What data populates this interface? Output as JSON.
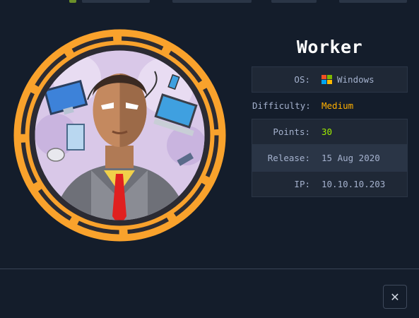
{
  "machine": {
    "name": "Worker",
    "info": [
      {
        "key": "OS:",
        "value": "Windows",
        "style": "normal",
        "icon": "windows-icon"
      },
      {
        "key": "Difficulty:",
        "value": "Medium",
        "style": "orange"
      },
      {
        "key": "Points:",
        "value": "30",
        "style": "green"
      },
      {
        "key": "Release:",
        "value": "15 Aug 2020",
        "style": "normal"
      },
      {
        "key": "IP:",
        "value": "10.10.10.203",
        "style": "normal"
      }
    ]
  },
  "dialog": {
    "close_glyph": "✕"
  },
  "colors": {
    "background": "#141d2b",
    "ring": "#f9a22c",
    "medium": "#ffaf00",
    "points": "#9fef00",
    "label": "#a4b1cd"
  }
}
